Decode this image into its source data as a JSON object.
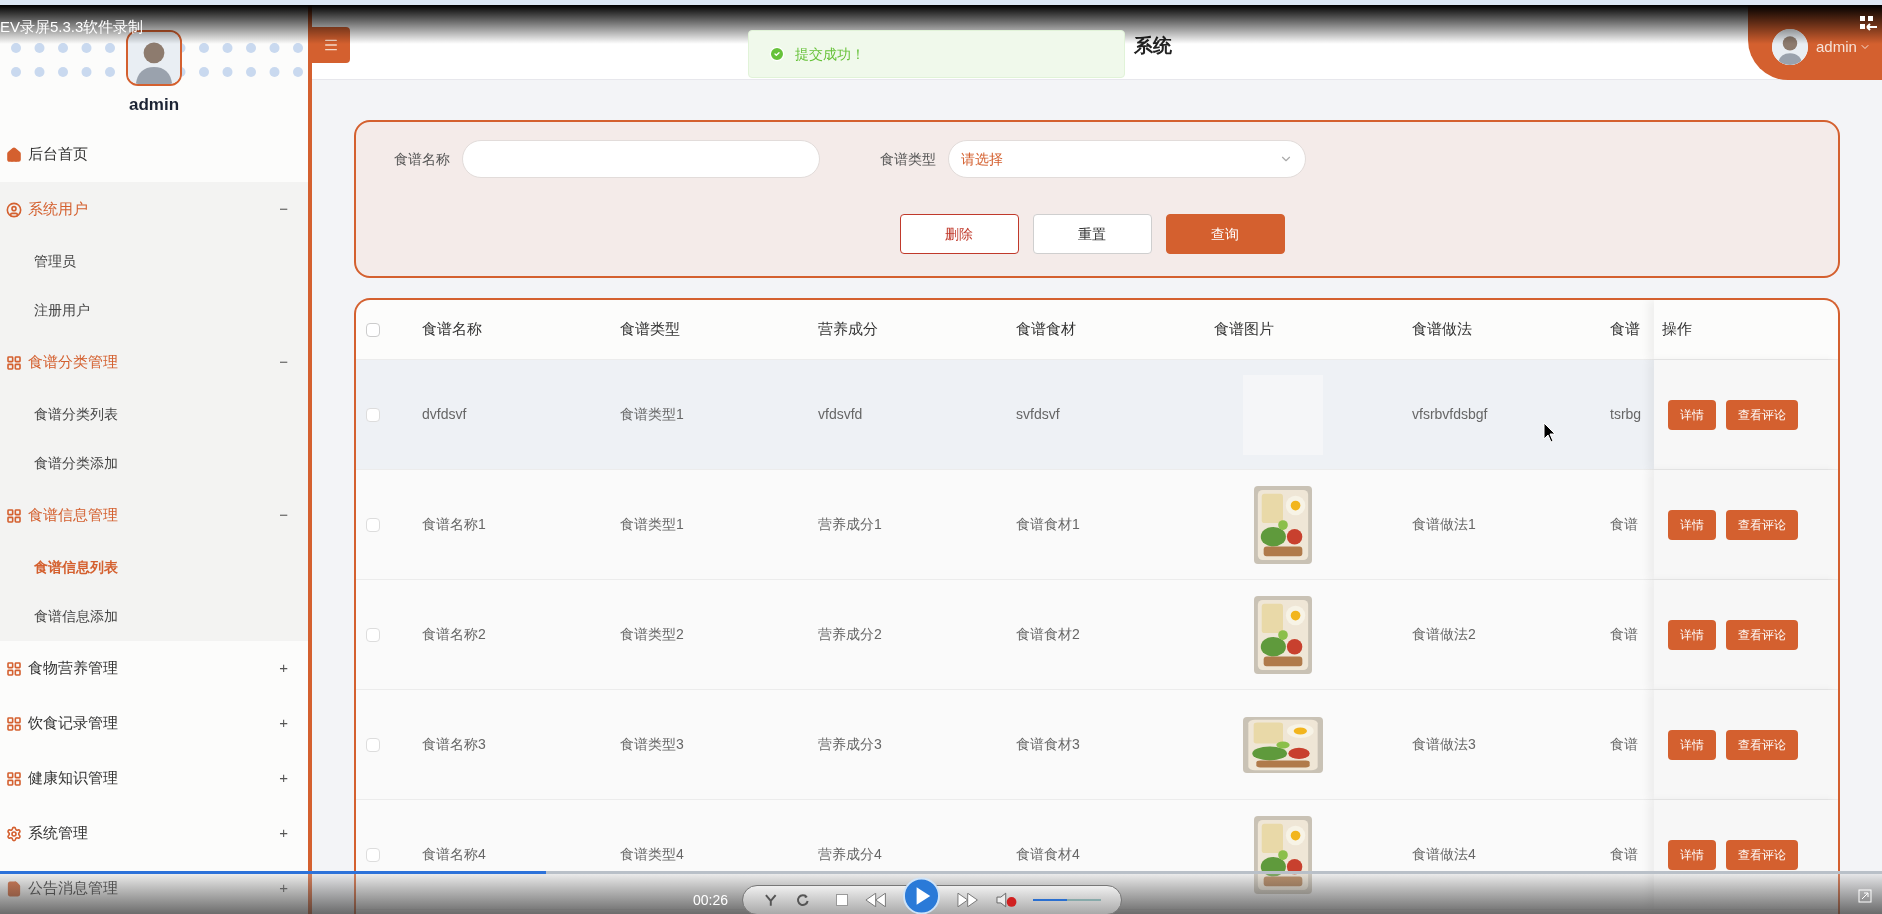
{
  "player": {
    "title": "EV录屏5.3.3软件录制",
    "time": "00:26",
    "progress": {
      "level": 0.29
    },
    "volume": {
      "level": 0.5
    },
    "muted": true
  },
  "toast": {
    "message": "提交成功！"
  },
  "header": {
    "title": "系统",
    "user": "admin"
  },
  "sidebar": {
    "user": "admin",
    "menu": [
      {
        "label": "后台首页",
        "kind": "home"
      },
      {
        "label": "系统用户",
        "kind": "user",
        "expanded": true,
        "toggle": "−",
        "children": [
          {
            "label": "管理员",
            "selected": false
          },
          {
            "label": "注册用户",
            "selected": false
          }
        ]
      },
      {
        "label": "食谱分类管理",
        "kind": "grid",
        "expanded": true,
        "toggle": "−",
        "children": [
          {
            "label": "食谱分类列表",
            "selected": false
          },
          {
            "label": "食谱分类添加",
            "selected": false
          }
        ]
      },
      {
        "label": "食谱信息管理",
        "kind": "grid",
        "expanded": true,
        "toggle": "−",
        "children": [
          {
            "label": "食谱信息列表",
            "selected": true
          },
          {
            "label": "食谱信息添加",
            "selected": false
          }
        ]
      },
      {
        "label": "食物营养管理",
        "kind": "grid",
        "expanded": false,
        "toggle": "+"
      },
      {
        "label": "饮食记录管理",
        "kind": "grid",
        "expanded": false,
        "toggle": "+"
      },
      {
        "label": "健康知识管理",
        "kind": "grid",
        "expanded": false,
        "toggle": "+"
      },
      {
        "label": "系统管理",
        "kind": "gear",
        "expanded": false,
        "toggle": "+"
      },
      {
        "label": "公告消息管理",
        "kind": "doc",
        "expanded": false,
        "toggle": "+"
      }
    ]
  },
  "search": {
    "fields": [
      {
        "label": "食谱名称",
        "kind": "input"
      },
      {
        "label": "食谱类型",
        "kind": "select",
        "placeholder": "请选择"
      }
    ],
    "buttons": [
      {
        "label": "删除",
        "kind": "danger"
      },
      {
        "label": "重置",
        "kind": "plain"
      },
      {
        "label": "查询",
        "kind": "primary"
      }
    ]
  },
  "table": {
    "all_checked": false,
    "columns": [
      "食谱名称",
      "食谱类型",
      "营养成分",
      "食谱食材",
      "食谱图片",
      "食谱做法",
      "食谱",
      "操作"
    ],
    "rows": [
      {
        "checked": false,
        "hovered": true,
        "cells": [
          "dvfdsvf",
          "食谱类型1",
          "vfdsvfd",
          "svfdsvf"
        ],
        "image": {
          "kind": "blank"
        },
        "cells2": [
          "vfsrbvfdsbgf",
          "tsrbg"
        ],
        "actions": [
          "详情",
          "查看评论"
        ]
      },
      {
        "checked": false,
        "hovered": false,
        "cells": [
          "食谱名称1",
          "食谱类型1",
          "营养成分1",
          "食谱食材1"
        ],
        "image": {
          "kind": "picture"
        },
        "cells2": [
          "食谱做法1",
          "食谱"
        ],
        "actions": [
          "详情",
          "查看评论"
        ]
      },
      {
        "checked": false,
        "hovered": false,
        "cells": [
          "食谱名称2",
          "食谱类型2",
          "营养成分2",
          "食谱食材2"
        ],
        "image": {
          "kind": "picture"
        },
        "cells2": [
          "食谱做法2",
          "食谱"
        ],
        "actions": [
          "详情",
          "查看评论"
        ]
      },
      {
        "checked": false,
        "hovered": false,
        "cells": [
          "食谱名称3",
          "食谱类型3",
          "营养成分3",
          "食谱食材3"
        ],
        "image": {
          "kind": "picture"
        },
        "cells2": [
          "食谱做法3",
          "食谱"
        ],
        "actions": [
          "详情",
          "查看评论"
        ]
      },
      {
        "checked": false,
        "hovered": false,
        "cells": [
          "食谱名称4",
          "食谱类型4",
          "营养成分4",
          "食谱食材4"
        ],
        "image": {
          "kind": "picture"
        },
        "cells2": [
          "食谱做法4",
          "食谱"
        ],
        "actions": [
          "详情",
          "查看评论"
        ]
      }
    ]
  }
}
